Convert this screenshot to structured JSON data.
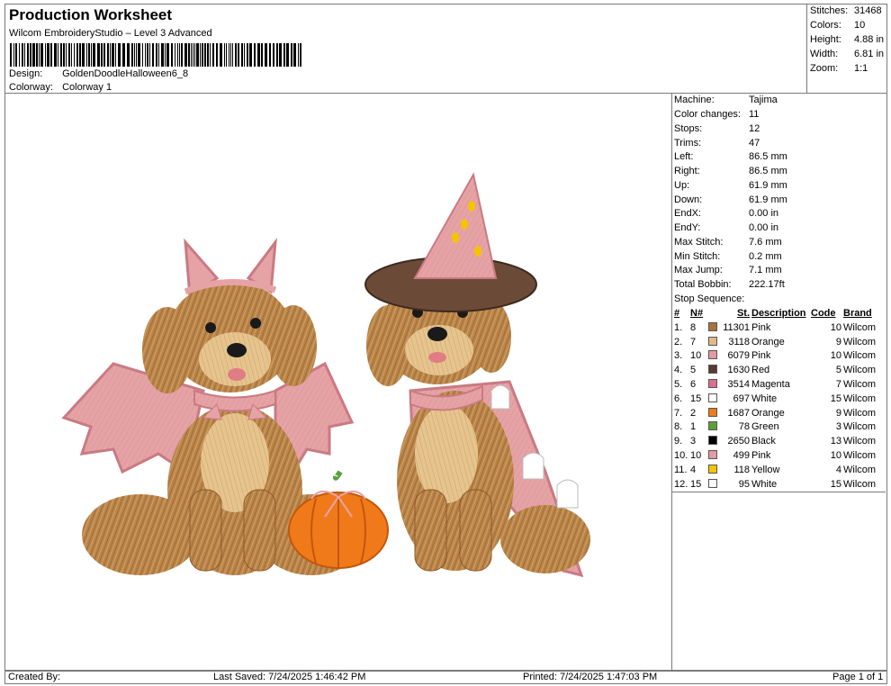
{
  "header": {
    "title": "Production Worksheet",
    "software": "Wilcom EmbroideryStudio – Level 3 Advanced",
    "design_label": "Design:",
    "design_value": "GoldenDoodleHalloween6_8",
    "colorway_label": "Colorway:",
    "colorway_value": "Colorway 1"
  },
  "stats": [
    {
      "label": "Stitches:",
      "value": "31468"
    },
    {
      "label": "Colors:",
      "value": "10"
    },
    {
      "label": "Height:",
      "value": "4.88 in"
    },
    {
      "label": "Width:",
      "value": "6.81 in"
    },
    {
      "label": "Zoom:",
      "value": "1:1"
    }
  ],
  "machine_info": [
    {
      "label": "Machine:",
      "value": "Tajima"
    },
    {
      "label": "Color changes:",
      "value": "11"
    },
    {
      "label": "Stops:",
      "value": "12"
    },
    {
      "label": "Trims:",
      "value": "47"
    },
    {
      "label": "Left:",
      "value": "86.5 mm"
    },
    {
      "label": "Right:",
      "value": "86.5 mm"
    },
    {
      "label": "Up:",
      "value": "61.9 mm"
    },
    {
      "label": "Down:",
      "value": "61.9 mm"
    },
    {
      "label": "EndX:",
      "value": "0.00 in"
    },
    {
      "label": "EndY:",
      "value": "0.00 in"
    },
    {
      "label": "Max Stitch:",
      "value": "7.6 mm"
    },
    {
      "label": "Min Stitch:",
      "value": "0.2 mm"
    },
    {
      "label": "Max Jump:",
      "value": "7.1 mm"
    },
    {
      "label": "Total Bobbin:",
      "value": "222.17ft"
    }
  ],
  "stop_sequence": {
    "title": "Stop Sequence:",
    "headers": [
      "#",
      "N#",
      "St.",
      "Description",
      "Code",
      "Brand"
    ],
    "rows": [
      {
        "idx": "1.",
        "n": "8",
        "color": "#a8743e",
        "st": "11301",
        "desc": "Pink",
        "code": "10",
        "brand": "Wilcom"
      },
      {
        "idx": "2.",
        "n": "7",
        "color": "#e3b98a",
        "st": "3118",
        "desc": "Orange",
        "code": "9",
        "brand": "Wilcom"
      },
      {
        "idx": "3.",
        "n": "10",
        "color": "#e39aa0",
        "st": "6079",
        "desc": "Pink",
        "code": "10",
        "brand": "Wilcom"
      },
      {
        "idx": "4.",
        "n": "5",
        "color": "#5a3a2c",
        "st": "1630",
        "desc": "Red",
        "code": "5",
        "brand": "Wilcom"
      },
      {
        "idx": "5.",
        "n": "6",
        "color": "#d9708f",
        "st": "3514",
        "desc": "Magenta",
        "code": "7",
        "brand": "Wilcom"
      },
      {
        "idx": "6.",
        "n": "15",
        "color": "#ffffff",
        "st": "697",
        "desc": "White",
        "code": "15",
        "brand": "Wilcom"
      },
      {
        "idx": "7.",
        "n": "2",
        "color": "#f07a1a",
        "st": "1687",
        "desc": "Orange",
        "code": "9",
        "brand": "Wilcom"
      },
      {
        "idx": "8.",
        "n": "1",
        "color": "#5aa03a",
        "st": "78",
        "desc": "Green",
        "code": "3",
        "brand": "Wilcom"
      },
      {
        "idx": "9.",
        "n": "3",
        "color": "#000000",
        "st": "2650",
        "desc": "Black",
        "code": "13",
        "brand": "Wilcom"
      },
      {
        "idx": "10.",
        "n": "10",
        "color": "#e39aa0",
        "st": "499",
        "desc": "Pink",
        "code": "10",
        "brand": "Wilcom"
      },
      {
        "idx": "11.",
        "n": "4",
        "color": "#f5c400",
        "st": "118",
        "desc": "Yellow",
        "code": "4",
        "brand": "Wilcom"
      },
      {
        "idx": "12.",
        "n": "15",
        "color": "#ffffff",
        "st": "95",
        "desc": "White",
        "code": "15",
        "brand": "Wilcom"
      }
    ]
  },
  "footer": {
    "created_by": "Created By:",
    "last_saved": "Last Saved: 7/24/2025 1:46:42 PM",
    "printed": "Printed: 7/24/2025 1:47:03 PM",
    "page": "Page 1 of 1"
  }
}
